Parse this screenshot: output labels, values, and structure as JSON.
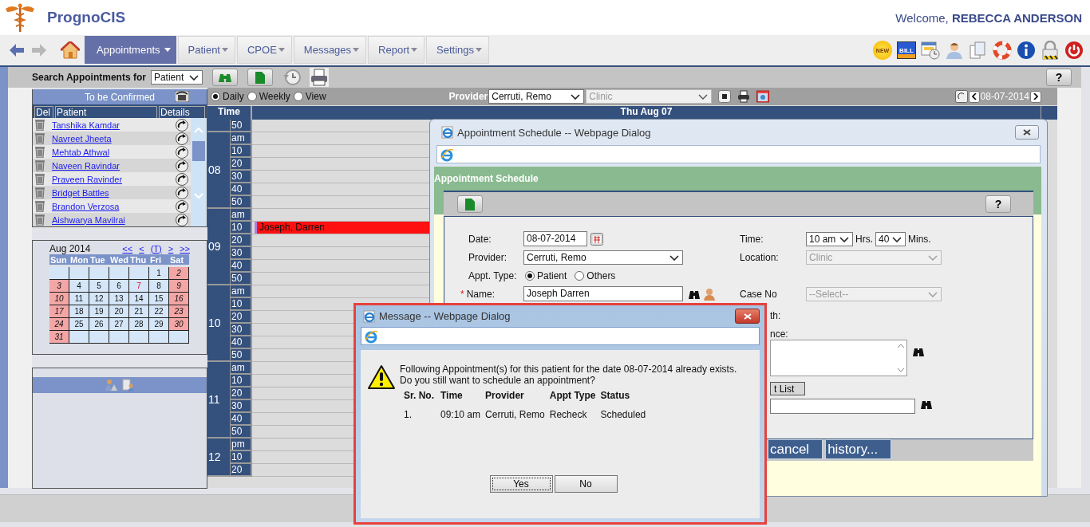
{
  "header": {
    "app_name": "PrognoCIS",
    "welcome": "Welcome, **REBECCA ANDERSON**",
    "new_badge": "NEW",
    "bill_label": "BILL"
  },
  "nav": {
    "tabs": [
      {
        "label": "Appointments",
        "selected": true
      },
      {
        "label": "Patient",
        "selected": false
      },
      {
        "label": "CPOE",
        "selected": false
      },
      {
        "label": "Messages",
        "selected": false
      },
      {
        "label": "Report",
        "selected": false
      },
      {
        "label": "Settings",
        "selected": false
      }
    ]
  },
  "toolbar": {
    "search_label": "Search Appointments for",
    "search_for": "Patient",
    "help": "?"
  },
  "to_be_confirmed": {
    "title": "To be Confirmed",
    "columns": [
      "Del",
      "Patient",
      "Details"
    ],
    "patients": [
      "Tanshika Kamdar",
      "Navreet Jheeta",
      "Mehtab Athwal",
      "Naveen Ravindar",
      "Praveen Ravinder",
      "Bridget Battles",
      "Brandon Verzosa",
      "Aishwarya Mavilrai"
    ]
  },
  "calendar": {
    "month": "Aug 2014",
    "nav": [
      "<<",
      "<",
      "(T)",
      ">",
      ">>"
    ],
    "weekdays": [
      "Sun",
      "Mon",
      "Tue",
      "Wed",
      "Thu",
      "Fri",
      "Sat"
    ],
    "weeks": [
      [
        {
          "kind": "blank"
        },
        {
          "kind": "blank"
        },
        {
          "kind": "blank"
        },
        {
          "kind": "blank"
        },
        {
          "kind": "blank"
        },
        {
          "kind": "day",
          "day": "1",
          "weekend": false,
          "today": false
        },
        {
          "kind": "day",
          "day": "2",
          "weekend": true,
          "today": false
        }
      ],
      [
        {
          "kind": "day",
          "day": "3",
          "weekend": true,
          "today": false
        },
        {
          "kind": "day",
          "day": "4",
          "weekend": false,
          "today": false
        },
        {
          "kind": "day",
          "day": "5",
          "weekend": false,
          "today": false
        },
        {
          "kind": "day",
          "day": "6",
          "weekend": false,
          "today": false
        },
        {
          "kind": "day",
          "day": "7",
          "weekend": false,
          "today": true
        },
        {
          "kind": "day",
          "day": "8",
          "weekend": false,
          "today": false
        },
        {
          "kind": "day",
          "day": "9",
          "weekend": true,
          "today": false
        }
      ],
      [
        {
          "kind": "day",
          "day": "10",
          "weekend": true,
          "today": false
        },
        {
          "kind": "day",
          "day": "11",
          "weekend": false,
          "today": false
        },
        {
          "kind": "day",
          "day": "12",
          "weekend": false,
          "today": false
        },
        {
          "kind": "day",
          "day": "13",
          "weekend": false,
          "today": false
        },
        {
          "kind": "day",
          "day": "14",
          "weekend": false,
          "today": false
        },
        {
          "kind": "day",
          "day": "15",
          "weekend": false,
          "today": false
        },
        {
          "kind": "day",
          "day": "16",
          "weekend": true,
          "today": false
        }
      ],
      [
        {
          "kind": "day",
          "day": "17",
          "weekend": true,
          "today": false
        },
        {
          "kind": "day",
          "day": "18",
          "weekend": false,
          "today": false
        },
        {
          "kind": "day",
          "day": "19",
          "weekend": false,
          "today": false
        },
        {
          "kind": "day",
          "day": "20",
          "weekend": false,
          "today": false
        },
        {
          "kind": "day",
          "day": "21",
          "weekend": false,
          "today": false
        },
        {
          "kind": "day",
          "day": "22",
          "weekend": false,
          "today": false
        },
        {
          "kind": "day",
          "day": "23",
          "weekend": true,
          "today": false
        }
      ],
      [
        {
          "kind": "day",
          "day": "24",
          "weekend": true,
          "today": false
        },
        {
          "kind": "day",
          "day": "25",
          "weekend": false,
          "today": false
        },
        {
          "kind": "day",
          "day": "26",
          "weekend": false,
          "today": false
        },
        {
          "kind": "day",
          "day": "27",
          "weekend": false,
          "today": false
        },
        {
          "kind": "day",
          "day": "28",
          "weekend": false,
          "today": false
        },
        {
          "kind": "day",
          "day": "29",
          "weekend": false,
          "today": false
        },
        {
          "kind": "day",
          "day": "30",
          "weekend": true,
          "today": false
        }
      ],
      [
        {
          "kind": "day",
          "day": "31",
          "weekend": true,
          "today": false
        },
        {
          "kind": "blank"
        },
        {
          "kind": "blank"
        },
        {
          "kind": "blank"
        },
        {
          "kind": "blank"
        },
        {
          "kind": "blank"
        },
        {
          "kind": "blank"
        }
      ]
    ]
  },
  "schedule": {
    "views": [
      {
        "label": "Daily",
        "selected": true
      },
      {
        "label": "Weekly",
        "selected": false
      },
      {
        "label": "View",
        "selected": false
      }
    ],
    "provider_label": "Provider",
    "provider": "Cerruti, Remo",
    "location": "Clinic",
    "date": "08-07-2014",
    "time_header": "Time",
    "day_header": "Thu Aug 07",
    "hours": [
      {
        "slots": [
          {
            "label": "50"
          }
        ]
      },
      {
        "hour": "08",
        "slots": [
          {
            "label": "am"
          },
          {
            "label": "10"
          },
          {
            "label": "20"
          },
          {
            "label": "30"
          },
          {
            "label": "40"
          },
          {
            "label": "50"
          }
        ]
      },
      {
        "hour": "09",
        "slots": [
          {
            "label": "am"
          },
          {
            "label": "10",
            "appointment": "Joseph, Darren"
          },
          {
            "label": "20"
          },
          {
            "label": "30"
          },
          {
            "label": "40"
          },
          {
            "label": "50"
          }
        ]
      },
      {
        "hour": "10",
        "slots": [
          {
            "label": "am"
          },
          {
            "label": "10"
          },
          {
            "label": "20"
          },
          {
            "label": "30"
          },
          {
            "label": "40"
          },
          {
            "label": "50"
          }
        ]
      },
      {
        "hour": "11",
        "slots": [
          {
            "label": "am"
          },
          {
            "label": "10"
          },
          {
            "label": "20"
          },
          {
            "label": "30"
          },
          {
            "label": "40"
          },
          {
            "label": "50"
          }
        ]
      },
      {
        "hour": "12",
        "slots": [
          {
            "label": "pm"
          },
          {
            "label": "10"
          },
          {
            "label": "20"
          }
        ]
      }
    ]
  },
  "appointment_dialog": {
    "title": "Appointment Schedule -- Webpage Dialog",
    "section_title": "Appointment Schedule",
    "help": "?",
    "date_label": "Date:",
    "date": "08-07-2014",
    "provider_label": "Provider:",
    "provider": "Cerruti, Remo",
    "appt_type_label": "Appt. Type:",
    "appt_types": [
      {
        "label": "Patient",
        "selected": true
      },
      {
        "label": "Others",
        "selected": false
      }
    ],
    "required_mark": "*",
    "name_label": "Name:",
    "name": "Joseph Darren",
    "time_label": "Time:",
    "hours": "10 am",
    "hrs_label": "Hrs.",
    "minutes": "40",
    "mins_label": "Mins.",
    "location_label": "Location:",
    "location": "Clinic",
    "case_no_label": "Case No",
    "case_no": "--Select--",
    "partial_labels": [
      "th:",
      "nce:"
    ],
    "list_button": "t List",
    "buttons": [
      "cancel",
      "history..."
    ]
  },
  "message_dialog": {
    "title": "Message -- Webpage Dialog",
    "text": "Following Appointment(s) for this patient for the date 08-07-2014 already exists. Do you still want to schedule an appointment?",
    "columns": [
      "Sr. No.",
      "Time",
      "Provider",
      "Appt Type",
      "Status"
    ],
    "rows": [
      [
        "1.",
        "09:10 am",
        "Cerruti, Remo",
        "Recheck",
        "Scheduled"
      ]
    ],
    "buttons": [
      {
        "label": "Yes",
        "focused": true
      },
      {
        "label": "No",
        "focused": false
      }
    ]
  }
}
